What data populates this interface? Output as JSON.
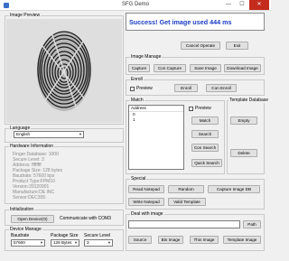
{
  "window": {
    "title": "SFG Demo",
    "min_glyph": "—",
    "max_glyph": "☐",
    "close_glyph": "✕"
  },
  "image_preview": {
    "legend": "Image Preview"
  },
  "status_text": "Success! Get image used 444 ms",
  "top_buttons": {
    "cancel": "Cancel Operate",
    "exit": "Exit"
  },
  "language": {
    "legend": "Language",
    "selected": "English",
    "arrow": "▼"
  },
  "hardware": {
    "legend": "Hardware Information",
    "lines": [
      "Finger Database: 1000",
      "Secure Level: 3",
      "Address: ffffffff",
      "Package Size: 128 bytes",
      "Baudrate: 57600 bps",
      "Product Type:FPM10",
      "Version:20120901",
      "Manufacture:DE INC",
      "Sensor:DEC305"
    ]
  },
  "initialization": {
    "legend": "Initialization",
    "open_device": "Open Device(O)",
    "communicate": "Communicate with COM3"
  },
  "device_manage": {
    "legend": "Device Manage",
    "baudrate_label": "Baudrate",
    "baudrate_value": "57600",
    "package_label": "Package Size",
    "package_value": "128 Bytes",
    "secure_label": "Secure Level",
    "secure_value": "3"
  },
  "image_manage": {
    "legend": "Image Manage",
    "buttons": [
      "Capture",
      "Con Capture",
      "Save Image",
      "Download Image"
    ]
  },
  "enroll": {
    "legend": "Enroll",
    "preview_label": "Preview",
    "enroll_button": "Enroll",
    "con_enroll_button": "Con Enroll"
  },
  "match": {
    "legend": "Match",
    "list_header": "Address",
    "list_items": [
      "0",
      "1"
    ],
    "preview_label": "Preview",
    "buttons": [
      "Match",
      "Search",
      "Con Search",
      "Quick Search"
    ]
  },
  "template_db": {
    "legend": "Template Database",
    "empty": "Empty",
    "delete": "Delete"
  },
  "special": {
    "legend": "Special",
    "buttons_row1": [
      "Read Notepad",
      "Random",
      "Capture Image DB"
    ],
    "buttons_row2": [
      "Write Notepad",
      "Valid Template"
    ]
  },
  "deal_image": {
    "legend": "Deal with image",
    "path_button": "Path",
    "buttons": [
      "Source",
      "Bin Image",
      "Thin Image",
      "Template Image"
    ]
  }
}
